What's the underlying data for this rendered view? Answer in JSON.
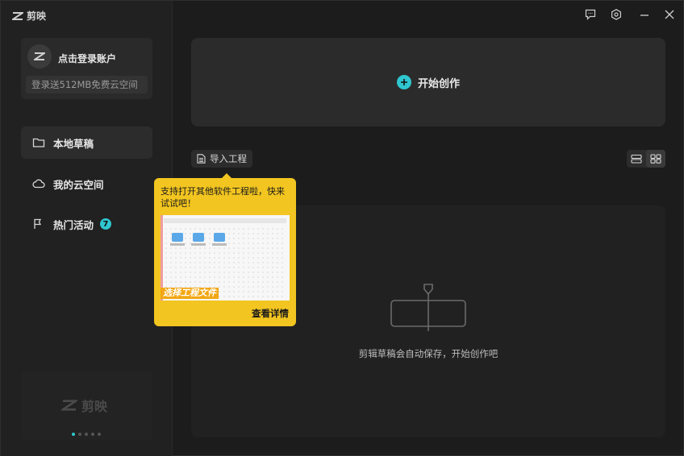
{
  "app": {
    "name": "剪映"
  },
  "titlebar": {
    "icons": [
      "feedback-icon",
      "settings-icon",
      "minimize-icon",
      "close-icon"
    ]
  },
  "sidebar": {
    "login": {
      "title": "点击登录账户",
      "subtitle": "登录送512MB免费云空间"
    },
    "items": [
      {
        "label": "本地草稿",
        "icon": "folder-icon",
        "active": true
      },
      {
        "label": "我的云空间",
        "icon": "cloud-icon",
        "active": false
      },
      {
        "label": "热门活动",
        "icon": "flag-icon",
        "active": false,
        "badge": "7"
      }
    ],
    "promo": {
      "brand": "剪映",
      "dots": 5,
      "active_dot": 0
    }
  },
  "main": {
    "create_label": "开始创作",
    "import_label": "导入工程",
    "empty_text": "剪辑草稿会自动保存，开始创作吧"
  },
  "tooltip": {
    "text": "支持打开其他软件工程啦，快来试试吧！",
    "banner": "选择工程文件",
    "link": "查看详情"
  },
  "colors": {
    "accent": "#2fc6d0",
    "tooltip": "#f2c520"
  }
}
